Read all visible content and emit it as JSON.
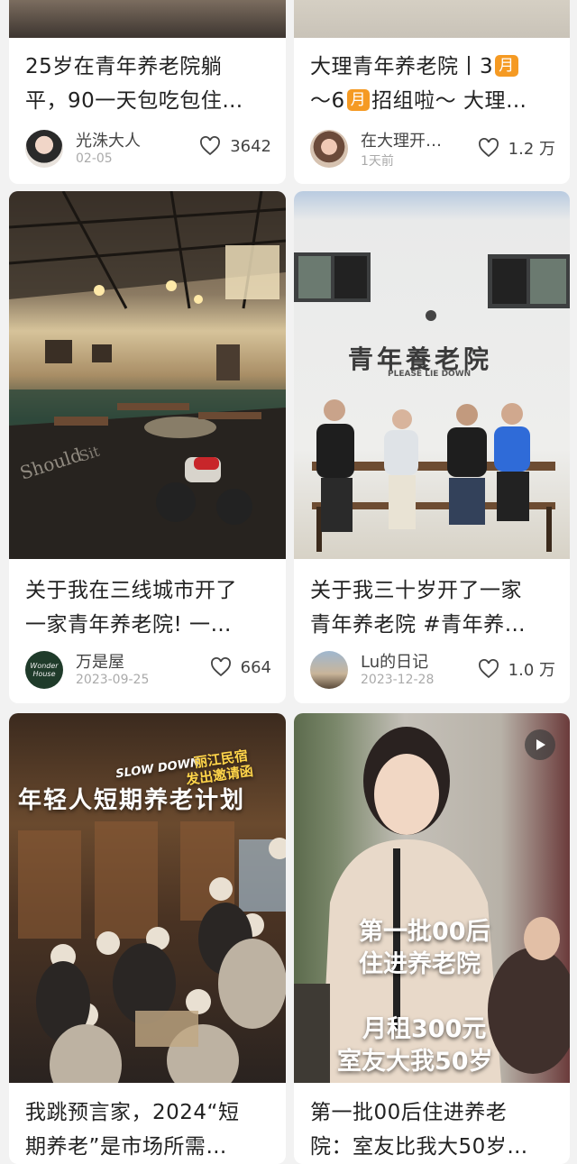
{
  "cards": [
    {
      "title_lines": [
        "25岁在青年养老院躺",
        "平，90一天包吃包住…"
      ],
      "author": "光洙大人",
      "date": "02-05",
      "likes": "3642"
    },
    {
      "title_parts": {
        "l1a": "大理青年养老院丨3",
        "l1b": "月",
        "l2a": "～6",
        "l2b": "月",
        "l2c": "招组啦～ 大理…"
      },
      "author": "在大理开…",
      "date": "1天前",
      "likes": "1.2 万"
    },
    {
      "title_lines": [
        "关于我在三线城市开了",
        "一家青年养老院! 一…"
      ],
      "author": "万是屋",
      "date": "2023-09-25",
      "likes": "664",
      "avatar_text": [
        "Wonder",
        "House"
      ]
    },
    {
      "title_lines": [
        "关于我三十岁开了一家",
        "青年养老院 #青年养…"
      ],
      "author": "Lu的日记",
      "date": "2023-12-28",
      "likes": "1.0 万",
      "image_text": {
        "sign": "青年養老院",
        "sub": "PLEASE LIE DOWN"
      }
    },
    {
      "title_lines": [
        "我跳预言家，2024“短",
        "期养老”是市场所需…"
      ],
      "image_text": {
        "tag": "SLOW DOWN",
        "line1": "丽江民宿",
        "line2": "发出邀请函",
        "headline": "年轻人短期养老计划"
      }
    },
    {
      "title_lines": [
        "第一批00后住进养老",
        "院：室友比我大50岁…"
      ],
      "image_text": {
        "l1": "第一批00后",
        "l2": "住进养老院",
        "l3": "月租300元",
        "l4": "室友大我50岁"
      }
    }
  ],
  "colors": {
    "accent": "#f59a23",
    "text": "#222222",
    "muted": "#aaaaaa"
  },
  "icons": {
    "like": "heart-icon",
    "video": "play-icon"
  }
}
